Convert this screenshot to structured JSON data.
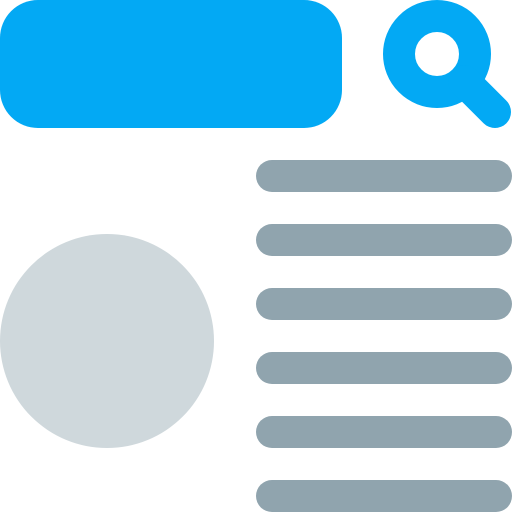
{
  "colors": {
    "background": "#FFFFFF",
    "accent": "#03A9F4",
    "image_placeholder": "#CFD8DC",
    "text_line": "#90A4AE"
  },
  "icons": {
    "search": "search-icon",
    "image": "image-placeholder-circle"
  },
  "content_lines": {
    "count": 6
  }
}
